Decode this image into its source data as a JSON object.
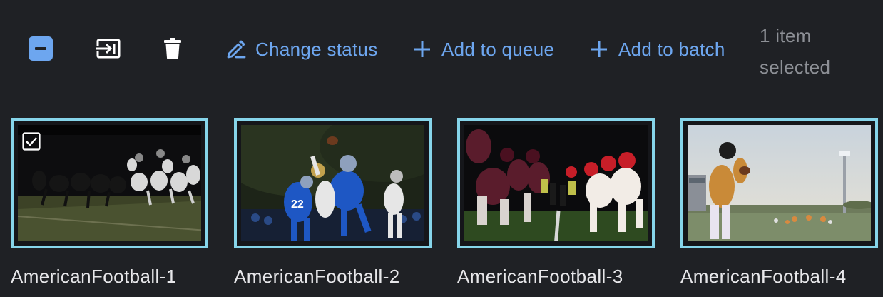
{
  "toolbar": {
    "select_toggle_icon": "minus-square-icon",
    "move_icon": "move-to-icon",
    "delete_icon": "trash-icon",
    "actions": [
      {
        "icon": "pencil-icon",
        "label": "Change status"
      },
      {
        "icon": "plus-icon",
        "label": "Add to queue"
      },
      {
        "icon": "plus-icon",
        "label": "Add to batch"
      }
    ],
    "selection_count": "1 item",
    "selection_suffix": "selected",
    "accent_color": "#6da6ef"
  },
  "gallery": {
    "border_color": "#86d5ea",
    "items": [
      {
        "name": "AmericanFootball-1",
        "selected": true
      },
      {
        "name": "AmericanFootball-2",
        "selected": false
      },
      {
        "name": "AmericanFootball-3",
        "selected": false
      },
      {
        "name": "AmericanFootball-4",
        "selected": false
      }
    ]
  }
}
